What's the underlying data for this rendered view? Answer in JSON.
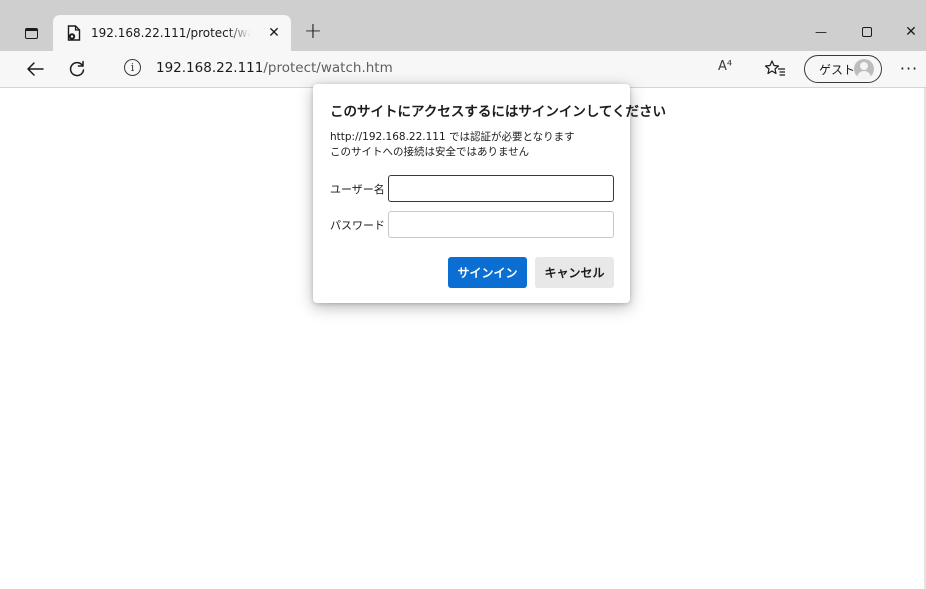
{
  "browser": {
    "tab": {
      "title": "192.168.22.111/protect/watch.htm",
      "close_glyph": "✕"
    },
    "new_tab_glyph": "+",
    "window_controls": {
      "minimize": "—",
      "close": "✕"
    },
    "toolbar": {
      "url_host": "192.168.22.111",
      "url_path": "/protect/watch.htm",
      "info_glyph": "i",
      "read_aloud_glyph": "A⁴",
      "profile_label": "ゲスト",
      "more_glyph": "···"
    }
  },
  "auth_dialog": {
    "title": "このサイトにアクセスするにはサインインしてください",
    "message_line1": "http://192.168.22.111 では認証が必要となります",
    "message_line2": "このサイトへの接続は安全ではありません",
    "username_label": "ユーザー名",
    "username_value": "",
    "password_label": "パスワード",
    "password_value": "",
    "signin_label": "サインイン",
    "cancel_label": "キャンセル"
  },
  "colors": {
    "tabstrip_bg": "#cfcfcf",
    "toolbar_bg": "#f7f7f7",
    "primary_button": "#0b6ed2",
    "secondary_button": "#e8e8e8"
  }
}
